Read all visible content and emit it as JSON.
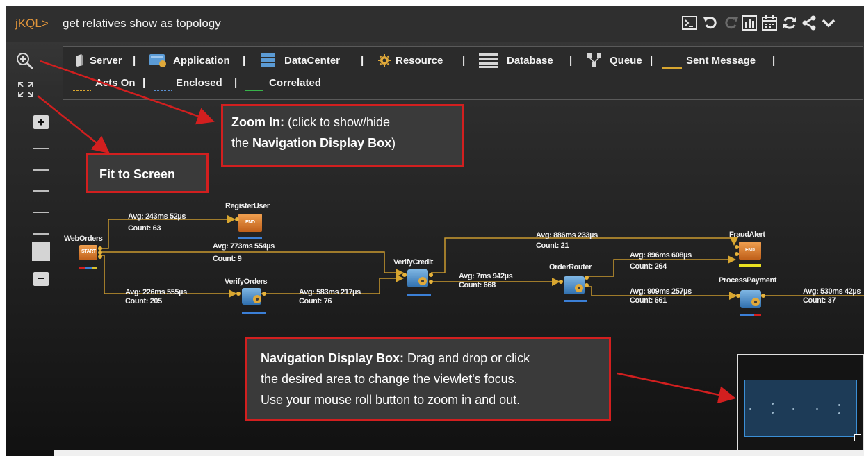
{
  "titlebar": {
    "prefix": "jKQL>",
    "query": "get relatives show as topology",
    "icons": [
      "console-icon",
      "undo-icon",
      "redo-icon",
      "chart-icon",
      "calendar-icon",
      "refresh-icon",
      "share-icon",
      "chevron-down-icon"
    ]
  },
  "legend": {
    "server": "Server",
    "application": "Application",
    "datacenter": "DataCenter",
    "resource": "Resource",
    "database": "Database",
    "queue": "Queue",
    "sent_message": "Sent Message",
    "acts_on": "Acts On",
    "enclosed": "Enclosed",
    "correlated": "Correlated",
    "sep": "|",
    "colors": {
      "sent_message": "#d8a630",
      "acts_on": "#d8a630",
      "enclosed": "#5a8fd0",
      "correlated": "#37b34a"
    }
  },
  "callouts": {
    "zoom_in": {
      "bold": "Zoom In:",
      "text1": " (click to show/hide",
      "text2a": "the ",
      "bold2": "Navigation Display Box",
      "text2b": ")"
    },
    "fit": {
      "bold": "Fit to Screen"
    },
    "nav": {
      "bold": "Navigation Display Box:",
      "text1": " Drag and drop or click",
      "text2": "the desired area to change the viewlet's focus.",
      "text3": "Use your mouse roll button to zoom in and out."
    }
  },
  "controls": {
    "plus": "+",
    "minus": "−"
  },
  "nodes": {
    "weborders": {
      "label": "WebOrders",
      "badge": "START"
    },
    "registeruser": {
      "label": "RegisterUser",
      "badge": "END"
    },
    "verifyorders": {
      "label": "VerifyOrders"
    },
    "verifycredit": {
      "label": "VerifyCredit"
    },
    "orderrouter": {
      "label": "OrderRouter"
    },
    "fraudalert": {
      "label": "FraudAlert",
      "badge": "END"
    },
    "processpayment": {
      "label": "ProcessPayment"
    }
  },
  "edges": {
    "e1": {
      "avg": "Avg: 243ms 52µs",
      "count": "Count: 63"
    },
    "e2": {
      "avg": "Avg: 773ms 554µs",
      "count": "Count: 9"
    },
    "e3": {
      "avg": "Avg: 226ms 555µs",
      "count": "Count: 205"
    },
    "e4": {
      "avg": "Avg: 583ms 217µs",
      "count": "Count: 76"
    },
    "e5": {
      "avg": "Avg: 7ms 942µs",
      "count": "Count: 668"
    },
    "e6": {
      "avg": "Avg: 886ms 233µs",
      "count": "Count: 21"
    },
    "e7": {
      "avg": "Avg: 896ms 608µs",
      "count": "Count: 264"
    },
    "e8": {
      "avg": "Avg: 909ms 257µs",
      "count": "Count: 661"
    },
    "e9": {
      "avg": "Avg: 530ms 42µs",
      "count": "Count: 37"
    }
  }
}
